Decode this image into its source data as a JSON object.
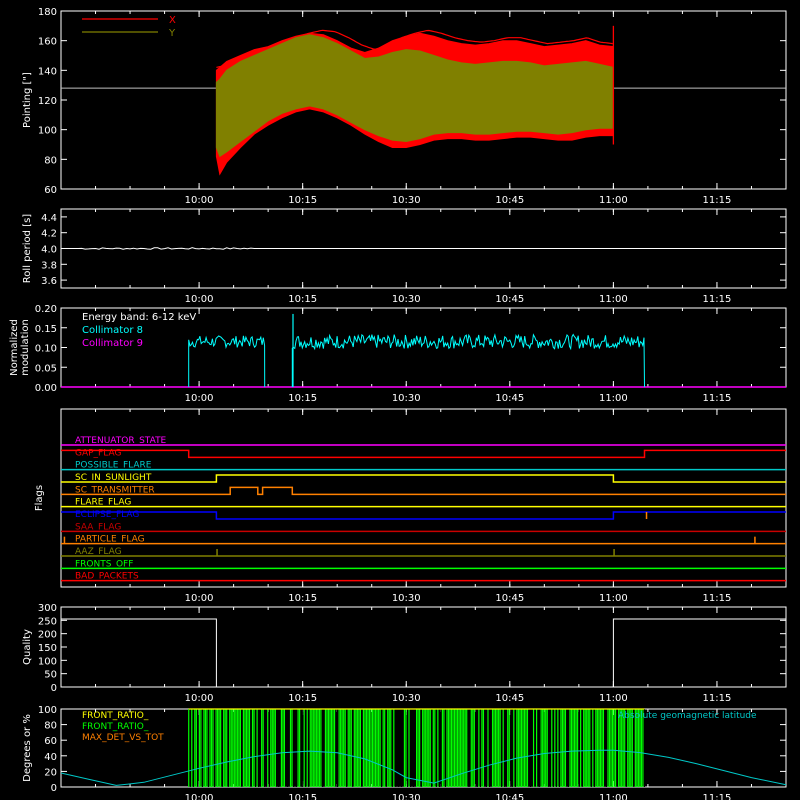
{
  "colors": {
    "background": "#000000",
    "axis": "#ffffff",
    "x_series": "#ff0000",
    "y_series": "#808000",
    "roll": "#ffffff",
    "collimator8": "#00ffff",
    "collimator9": "#ff00ff",
    "front_ratio_a": "#ffff00",
    "front_ratio_b": "#00ff00",
    "max_det": "#ff8000",
    "geomag": "#00c8c8",
    "quality": "#ffffff"
  },
  "time_axis": {
    "range_minutes": [
      -20,
      85
    ],
    "tick_minutes": [
      0,
      15,
      30,
      45,
      60,
      75
    ],
    "tick_labels": [
      "10:00",
      "10:15",
      "10:30",
      "10:45",
      "11:00",
      "11:15"
    ]
  },
  "chart_data": [
    {
      "id": "pointing",
      "type": "area",
      "title": "",
      "ylabel": "Pointing [\"]",
      "ylim": [
        60,
        180
      ],
      "yticks": [
        60,
        80,
        100,
        120,
        140,
        160,
        180
      ],
      "legend": [
        {
          "name": "X",
          "color": "#ff0000"
        },
        {
          "name": "Y",
          "color": "#808000"
        }
      ],
      "reference_line": 128,
      "data_start_minute": 2.5,
      "data_end_minute": 60,
      "series": [
        {
          "name": "X",
          "x": [
            2.5,
            3,
            4,
            6,
            8,
            10,
            12,
            14,
            16,
            18,
            20,
            22,
            24,
            26,
            28,
            30,
            32,
            34,
            36,
            38,
            40,
            42,
            44,
            46,
            48,
            50,
            52,
            54,
            56,
            58,
            60
          ],
          "low": [
            82,
            70,
            78,
            88,
            97,
            103,
            108,
            112,
            114,
            112,
            108,
            103,
            97,
            92,
            88,
            88,
            90,
            93,
            94,
            94,
            93,
            93,
            94,
            95,
            95,
            94,
            93,
            93,
            95,
            96,
            96
          ],
          "high": [
            140,
            142,
            146,
            150,
            154,
            156,
            160,
            163,
            165,
            164,
            160,
            155,
            152,
            155,
            160,
            163,
            165,
            163,
            160,
            158,
            157,
            158,
            160,
            160,
            158,
            156,
            157,
            158,
            160,
            157,
            156
          ]
        },
        {
          "name": "Y",
          "x": [
            2.5,
            3,
            4,
            6,
            8,
            10,
            12,
            14,
            16,
            18,
            20,
            22,
            24,
            26,
            28,
            30,
            32,
            34,
            36,
            38,
            40,
            42,
            44,
            46,
            48,
            50,
            52,
            54,
            56,
            58,
            60
          ],
          "low": [
            88,
            82,
            85,
            92,
            99,
            106,
            111,
            114,
            116,
            114,
            110,
            105,
            100,
            96,
            93,
            92,
            94,
            97,
            98,
            98,
            97,
            97,
            98,
            99,
            99,
            98,
            97,
            98,
            100,
            101,
            101
          ],
          "high": [
            132,
            134,
            140,
            146,
            150,
            154,
            158,
            162,
            164,
            162,
            158,
            153,
            148,
            149,
            152,
            154,
            153,
            150,
            147,
            145,
            144,
            145,
            146,
            146,
            145,
            143,
            144,
            145,
            146,
            144,
            142
          ]
        }
      ]
    },
    {
      "id": "roll",
      "type": "line",
      "ylabel": "Roll period [s]",
      "ylim": [
        3.5,
        4.5
      ],
      "yticks": [
        3.6,
        3.8,
        4.0,
        4.2,
        4.4
      ],
      "series": [
        {
          "name": "",
          "x": [
            -20,
            -10,
            0,
            10,
            20,
            30,
            40,
            50,
            60,
            70,
            80,
            85
          ],
          "values": [
            4.0,
            4.0,
            4.0,
            4.0,
            4.0,
            4.0,
            4.0,
            4.0,
            4.0,
            4.0,
            4.0,
            4.0
          ]
        }
      ]
    },
    {
      "id": "modulation",
      "type": "line",
      "ylabel": "Normalized modulation",
      "ylim": [
        0,
        0.2
      ],
      "yticks": [
        0.0,
        0.05,
        0.1,
        0.15,
        0.2
      ],
      "tick_labels_y": [
        "0.00",
        "0.05",
        "0.10",
        "0.15",
        "0.20"
      ],
      "annotation": "Energy band: 6-12 keV",
      "legend": [
        {
          "name": "Collimator 8",
          "color": "#00ffff"
        },
        {
          "name": "Collimator 9",
          "color": "#ff00ff"
        }
      ],
      "segments": [
        {
          "start": -1.5,
          "end": 9.5,
          "mean": 0.115,
          "jitter": 0.015,
          "spike": null
        },
        {
          "start": 13.5,
          "end": 64.5,
          "mean": 0.115,
          "jitter": 0.018,
          "spike": {
            "x": 13.6,
            "value": 0.185
          }
        }
      ],
      "collimator9_value": 0.0
    },
    {
      "id": "flags",
      "type": "line",
      "ylabel": "Flags",
      "flags": [
        {
          "name": "ATTENUATOR_STATE",
          "color": "#ff00ff",
          "segments": [
            [
              -20,
              85,
              0
            ]
          ]
        },
        {
          "name": "GAP_FLAG",
          "color": "#ff0000",
          "segments": [
            [
              -20,
              -1.5,
              0
            ],
            [
              -1.5,
              64.5,
              0
            ],
            [
              64.5,
              85,
              1
            ]
          ],
          "start_level": 1
        },
        {
          "name": "POSSIBLE_FLARE",
          "color": "#00c8c8",
          "segments": [
            [
              -20,
              85,
              0
            ]
          ]
        },
        {
          "name": "SC_IN_SUNLIGHT",
          "color": "#ffff00",
          "segments": [
            [
              -20,
              2.5,
              0
            ],
            [
              2.5,
              60,
              1
            ],
            [
              60,
              85,
              0
            ]
          ]
        },
        {
          "name": "SC_TRANSMITTER",
          "color": "#ff8000",
          "segments": [
            [
              -20,
              4.5,
              0
            ],
            [
              4.5,
              8.5,
              1
            ],
            [
              8.5,
              9.2,
              0
            ],
            [
              9.2,
              13.5,
              1
            ],
            [
              13.5,
              85,
              0
            ]
          ]
        },
        {
          "name": "FLARE_FLAG",
          "color": "#ffff00",
          "segments": [
            [
              -20,
              85,
              0
            ]
          ]
        },
        {
          "name": "ECLIPSE_FLAG",
          "color": "#0000ff",
          "segments": [
            [
              -20,
              2.5,
              1
            ],
            [
              2.5,
              60,
              0
            ],
            [
              60,
              85,
              1
            ]
          ]
        },
        {
          "name": "SAA_FLAG",
          "color": "#c80000",
          "segments": [
            [
              -20,
              85,
              0
            ]
          ]
        },
        {
          "name": "PARTICLE_FLAG",
          "color": "#ff8000",
          "segments": [
            [
              -20,
              85,
              0
            ]
          ]
        },
        {
          "name": "AAZ_FLAG",
          "color": "#808000",
          "segments": [
            [
              -20,
              85,
              0
            ]
          ]
        },
        {
          "name": "FRONTS_OFF",
          "color": "#00ff00",
          "segments": [
            [
              -20,
              85,
              0
            ]
          ]
        },
        {
          "name": "BAD_PACKETS",
          "color": "#ff0000",
          "segments": [
            [
              -20,
              85,
              0
            ]
          ]
        }
      ]
    },
    {
      "id": "quality",
      "type": "line",
      "ylabel": "Quality",
      "ylim": [
        0,
        300
      ],
      "yticks": [
        0,
        50,
        100,
        150,
        200,
        250,
        300
      ],
      "series": [
        {
          "name": "",
          "x": [
            -20,
            2.5,
            2.5,
            60,
            60,
            85
          ],
          "values": [
            255,
            255,
            0,
            0,
            255,
            255
          ]
        }
      ]
    },
    {
      "id": "front_ratio",
      "type": "bar",
      "ylabel": "Degrees or %",
      "ylim": [
        0,
        100
      ],
      "yticks": [
        0,
        20,
        40,
        60,
        80,
        100
      ],
      "legend": [
        {
          "name": "FRONT_RATIO_",
          "color": "#ffff00"
        },
        {
          "name": "FRONT_RATIO_",
          "color": "#00ff00"
        },
        {
          "name": "MAX_DET_VS_TOT",
          "color": "#ff8000"
        }
      ],
      "right_label": "Absolute geomagnetic latitude",
      "bars_start": -1.5,
      "bars_end": 64.5,
      "bars_value": 100,
      "latitude": {
        "x": [
          -20,
          -16,
          -12,
          -8,
          -4,
          0,
          4,
          8,
          12,
          16,
          20,
          24,
          28,
          30,
          34,
          38,
          42,
          46,
          50,
          54,
          58,
          60,
          64,
          68,
          72,
          76,
          80,
          85
        ],
        "values": [
          18,
          10,
          2,
          6,
          15,
          24,
          32,
          39,
          44,
          46,
          44,
          36,
          22,
          12,
          5,
          17,
          28,
          37,
          43,
          46,
          47,
          47,
          44,
          38,
          30,
          21,
          12,
          3
        ]
      }
    }
  ]
}
